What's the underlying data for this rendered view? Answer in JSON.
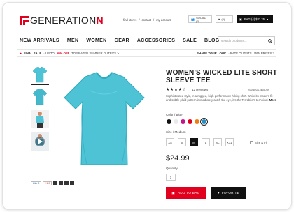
{
  "brand": {
    "name_start": "GENERATION",
    "name_end": "N"
  },
  "utility": {
    "find_stores": "find stores",
    "sep1": "/",
    "contact": "contact",
    "sep2": "/",
    "account": "my account"
  },
  "header_buttons": {
    "social": "SOCIAL (9)",
    "favorites": "(0)",
    "bag": "BAG (4)  $47.25",
    "bag_caret": "▾"
  },
  "nav": [
    "NEW ARRIVALS",
    "MEN",
    "WOMEN",
    "GEAR",
    "ACCESSORIES",
    "SALE",
    "BLOG"
  ],
  "search": {
    "placeholder": "search products...",
    "icon": "magnifier-icon"
  },
  "promo": {
    "left_bold": "FINAL SALE",
    "left_mid": "· UP TO",
    "left_red": "50% OFF",
    "left_end": "TOP RATED  SUMMER OUTFITS >",
    "right_bold": "SHARE YOUR LOOK",
    "right_end": "· RATE OUTFITS / WIN PRIZES >"
  },
  "product": {
    "title": "WOMEN'S WICKED LITE SHORT SLEEVE TEE",
    "stars": "★★★★☆",
    "rating": 4,
    "reviews": "12 Reviews",
    "sku": "SKU#GL-465-W",
    "description": "Sophisticated style, in a rugged, high-performance hiking shirt. While its modern fit and subtle plaid pattern immediately catch the eye, it's the Terrabite's technical",
    "more": "More",
    "color_label": "Color / Blue",
    "swatches": [
      "#111111",
      "#e9e9e9",
      "#c2168f",
      "#e1001e",
      "#ef7d14",
      "#2b8fc4"
    ],
    "selected_swatch": 5,
    "size_label": "Size / Medium",
    "sizes": [
      "XS",
      "S",
      "M",
      "L",
      "XL",
      "XXL"
    ],
    "selected_size": 2,
    "size_fit": "Size & Fit",
    "price": "$24.99",
    "quantity_label": "Quantity",
    "quantity": "1",
    "add_to_bag": "ADD TO BAG",
    "favorite": "FAVORITE"
  },
  "share": {
    "like": "Like",
    "like_count": "0",
    "plus": "+1",
    "plus_count": "0"
  },
  "colors": {
    "accent": "#e1001e",
    "tee": "#4fc3d6",
    "tee_shade": "#2ea9bd",
    "dark": "#111111"
  }
}
